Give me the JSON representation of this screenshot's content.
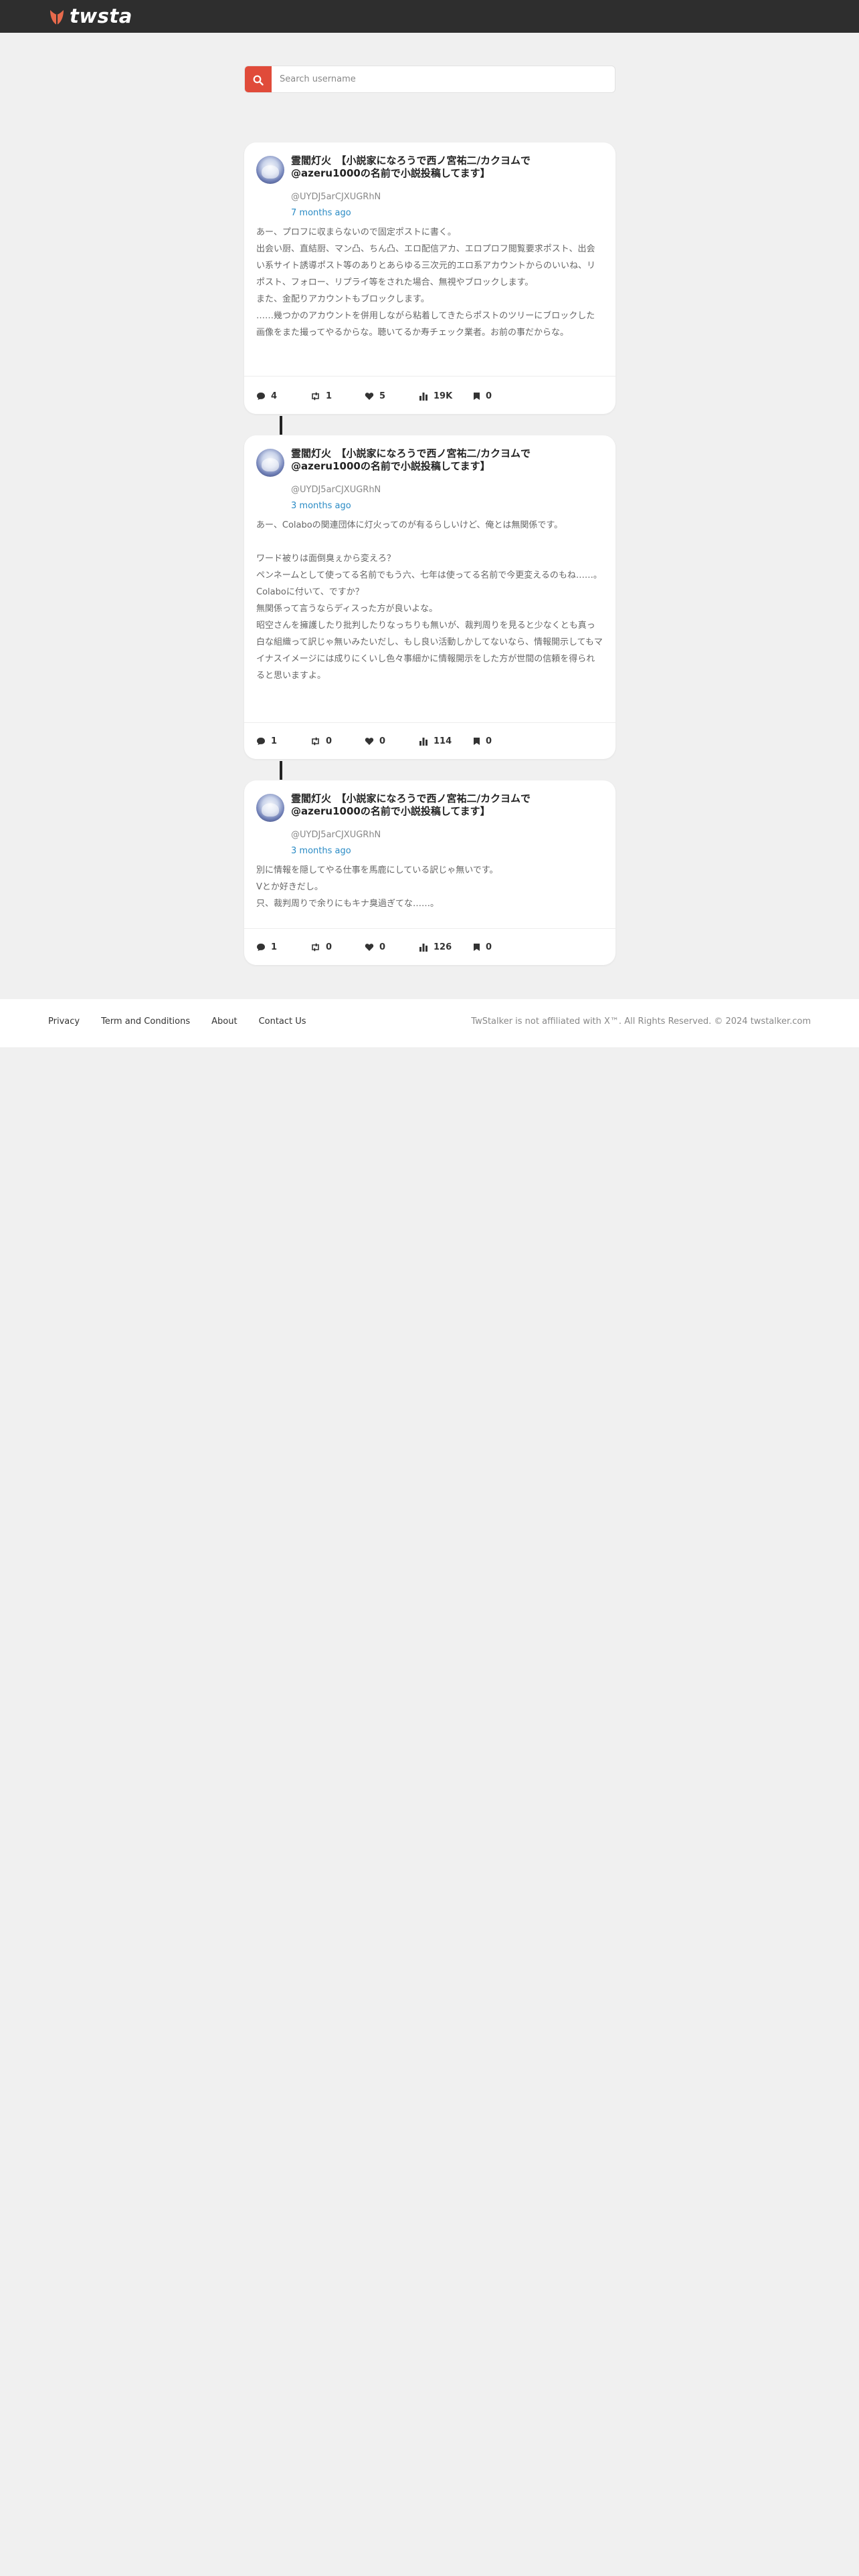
{
  "header": {
    "brand": "twstalker"
  },
  "search": {
    "placeholder": "Search username"
  },
  "posts": [
    {
      "author": "霊閻灯火　【小説家になろうで西ノ宮祐二/カクヨムで@azeru1000の名前で小説投稿してます】",
      "handle": "@UYDJ5arCJXUGRhN",
      "time": "7 months ago",
      "body": "あー、プロフに収まらないので固定ポストに書く。\n出会い厨、直結厨、マン凸、ちん凸、エロ配信アカ、エロプロフ閲覧要求ポスト、出会い系サイト誘導ポスト等のありとあらゆる三次元的エロ系アカウントからのいいね、リポスト、フォロー、リプライ等をされた場合、無視やブロックします。\nまた、金配りアカウントもブロックします。\n……幾つかのアカウントを併用しながら粘着してきたらポストのツリーにブロックした画像をまた撮ってやるからな。聴いてるか寿チェック業者。お前の事だからな。",
      "stats": {
        "replies": "4",
        "retweets": "1",
        "likes": "5",
        "views": "19K",
        "bookmarks": "0"
      }
    },
    {
      "author": "霊閻灯火　【小説家になろうで西ノ宮祐二/カクヨムで@azeru1000の名前で小説投稿してます】",
      "handle": "@UYDJ5arCJXUGRhN",
      "time": "3 months ago",
      "body": "あー、Colaboの関連団体に灯火ってのが有るらしいけど、俺とは無関係です。\n\nワード被りは面倒臭ぇから変えろ？\nペンネームとして使ってる名前でもう六、七年は使ってる名前で今更変えるのもね……。\nColaboに付いて、ですか？\n無関係って言うならディスった方が良いよな。\n昭空さんを擁護したり批判したりなっちりも無いが、裁判周りを見ると少なくとも真っ白な組織って訳じゃ無いみたいだし、もし良い活動しかしてないなら、情報開示してもマイナスイメージには成りにくいし色々事細かに情報開示をした方が世間の信頼を得られると思いますよ。",
      "stats": {
        "replies": "1",
        "retweets": "0",
        "likes": "0",
        "views": "114",
        "bookmarks": "0"
      }
    },
    {
      "author": "霊閻灯火　【小説家になろうで西ノ宮祐二/カクヨムで@azeru1000の名前で小説投稿してます】",
      "handle": "@UYDJ5arCJXUGRhN",
      "time": "3 months ago",
      "body": "別に情報を隠してやる仕事を馬鹿にしている訳じゃ無いです。\nVとか好きだし。\n只、裁判周りで余りにもキナ臭過ぎてな……。",
      "stats": {
        "replies": "1",
        "retweets": "0",
        "likes": "0",
        "views": "126",
        "bookmarks": "0"
      }
    }
  ],
  "footer": {
    "links": [
      "Privacy",
      "Term and Conditions",
      "About",
      "Contact Us"
    ],
    "copyright": "TwStalker is not affiliated with X™. All Rights Reserved. © 2024 twstalker.com"
  },
  "colors": {
    "topbar": "#2e2e2e",
    "accent": "#e04b3a",
    "link": "#2a8bc5",
    "background": "#f0f0f0"
  }
}
